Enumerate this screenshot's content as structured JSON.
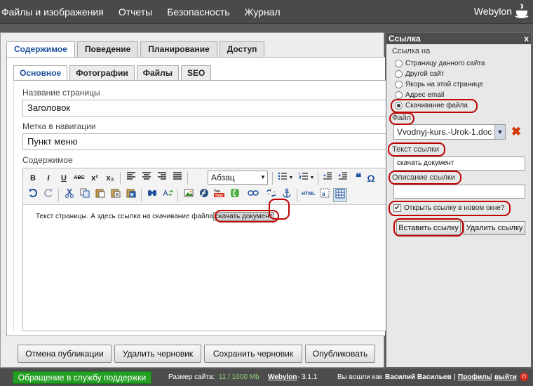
{
  "topnav": [
    "Файлы и изображения",
    "Отчеты",
    "Безопасность",
    "Журнал"
  ],
  "brand": "Webylon",
  "tabs": [
    "Содержимое",
    "Поведение",
    "Планирование",
    "Доступ"
  ],
  "subtabs": [
    "Основное",
    "Фотографии",
    "Файлы",
    "SEO"
  ],
  "form": {
    "title_label": "Название страницы",
    "title_value": "Заголовок",
    "menu_label": "Метка в навигации",
    "menu_value": "Пункт меню",
    "content_label": "Содержимое"
  },
  "editor": {
    "format_value": "Абзац",
    "text_before": "Текст страницы. А здесь ссылка на скачивание файла",
    "link_text": "скачать документ",
    "text_after": ".",
    "buttons": {
      "bold": "B",
      "italic": "I",
      "underline": "U",
      "strike": "ABC",
      "superscript": "x²",
      "subscript": "x₂",
      "quote": "❝",
      "omega": "Ω"
    }
  },
  "bottom_buttons": [
    "Отмена публикации",
    "Удалить черновик",
    "Сохранить черновик",
    "Опубликовать"
  ],
  "dialog": {
    "title": "Ссылка",
    "close": "x",
    "link_to_label": "Ссылка на",
    "options": [
      "Страницу данного сайта",
      "Другой сайт",
      "Якорь на этой странице",
      "Адрес email",
      "Скачивание файла"
    ],
    "selected_option": "Скачивание файла",
    "file_label": "Файл",
    "file_value": "Vvodnyj-kurs.-Urok-1.doc",
    "link_text_label": "Текст ссылки",
    "link_text_value": "скачать документ",
    "description_label": "Описание ссылки",
    "description_value": "",
    "new_window_label": "Открыть ссылку в новом окне?",
    "new_window_checked": true,
    "insert_button": "Вставить ссылку",
    "remove_button": "Удалить ссылку"
  },
  "footer": {
    "support_button": "Обращение в службу поддержки",
    "size_label": "Размер сайта:",
    "size_value": "11 / 1000 Mb",
    "cms_name": "Webylon",
    "version": "-   3.1.1",
    "logged_in_label": "Вы вошли как",
    "user_name": "Василий Васильев",
    "profile_link": "Профиль",
    "logout_link": "выйти"
  },
  "colors": {
    "topbar": "#4a4a4a",
    "accent_tab": "#1a4f9c",
    "highlight_ring": "#c00000",
    "support_green": "#23a023"
  }
}
